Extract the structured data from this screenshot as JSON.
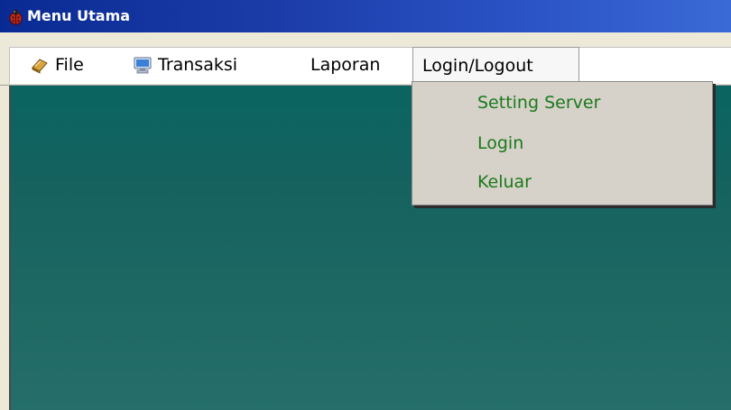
{
  "window": {
    "title": "Menu Utama",
    "title_icon": "ladybug-icon",
    "titlebar_color": "#0a2a93"
  },
  "menubar": {
    "items": [
      {
        "label": "File",
        "icon": "book-icon"
      },
      {
        "label": "Transaksi",
        "icon": "computer-icon"
      },
      {
        "label": "Laporan",
        "icon": ""
      },
      {
        "label": "Login/Logout",
        "icon": ""
      }
    ],
    "active_item": "Login/Logout"
  },
  "dropdown": {
    "items": [
      {
        "label": "Setting Server"
      },
      {
        "label": "Login"
      },
      {
        "label": "Keluar"
      }
    ],
    "text_color": "#1a7a1a",
    "background": "#d6d1c9"
  },
  "mdi": {
    "background": "#15625f"
  }
}
